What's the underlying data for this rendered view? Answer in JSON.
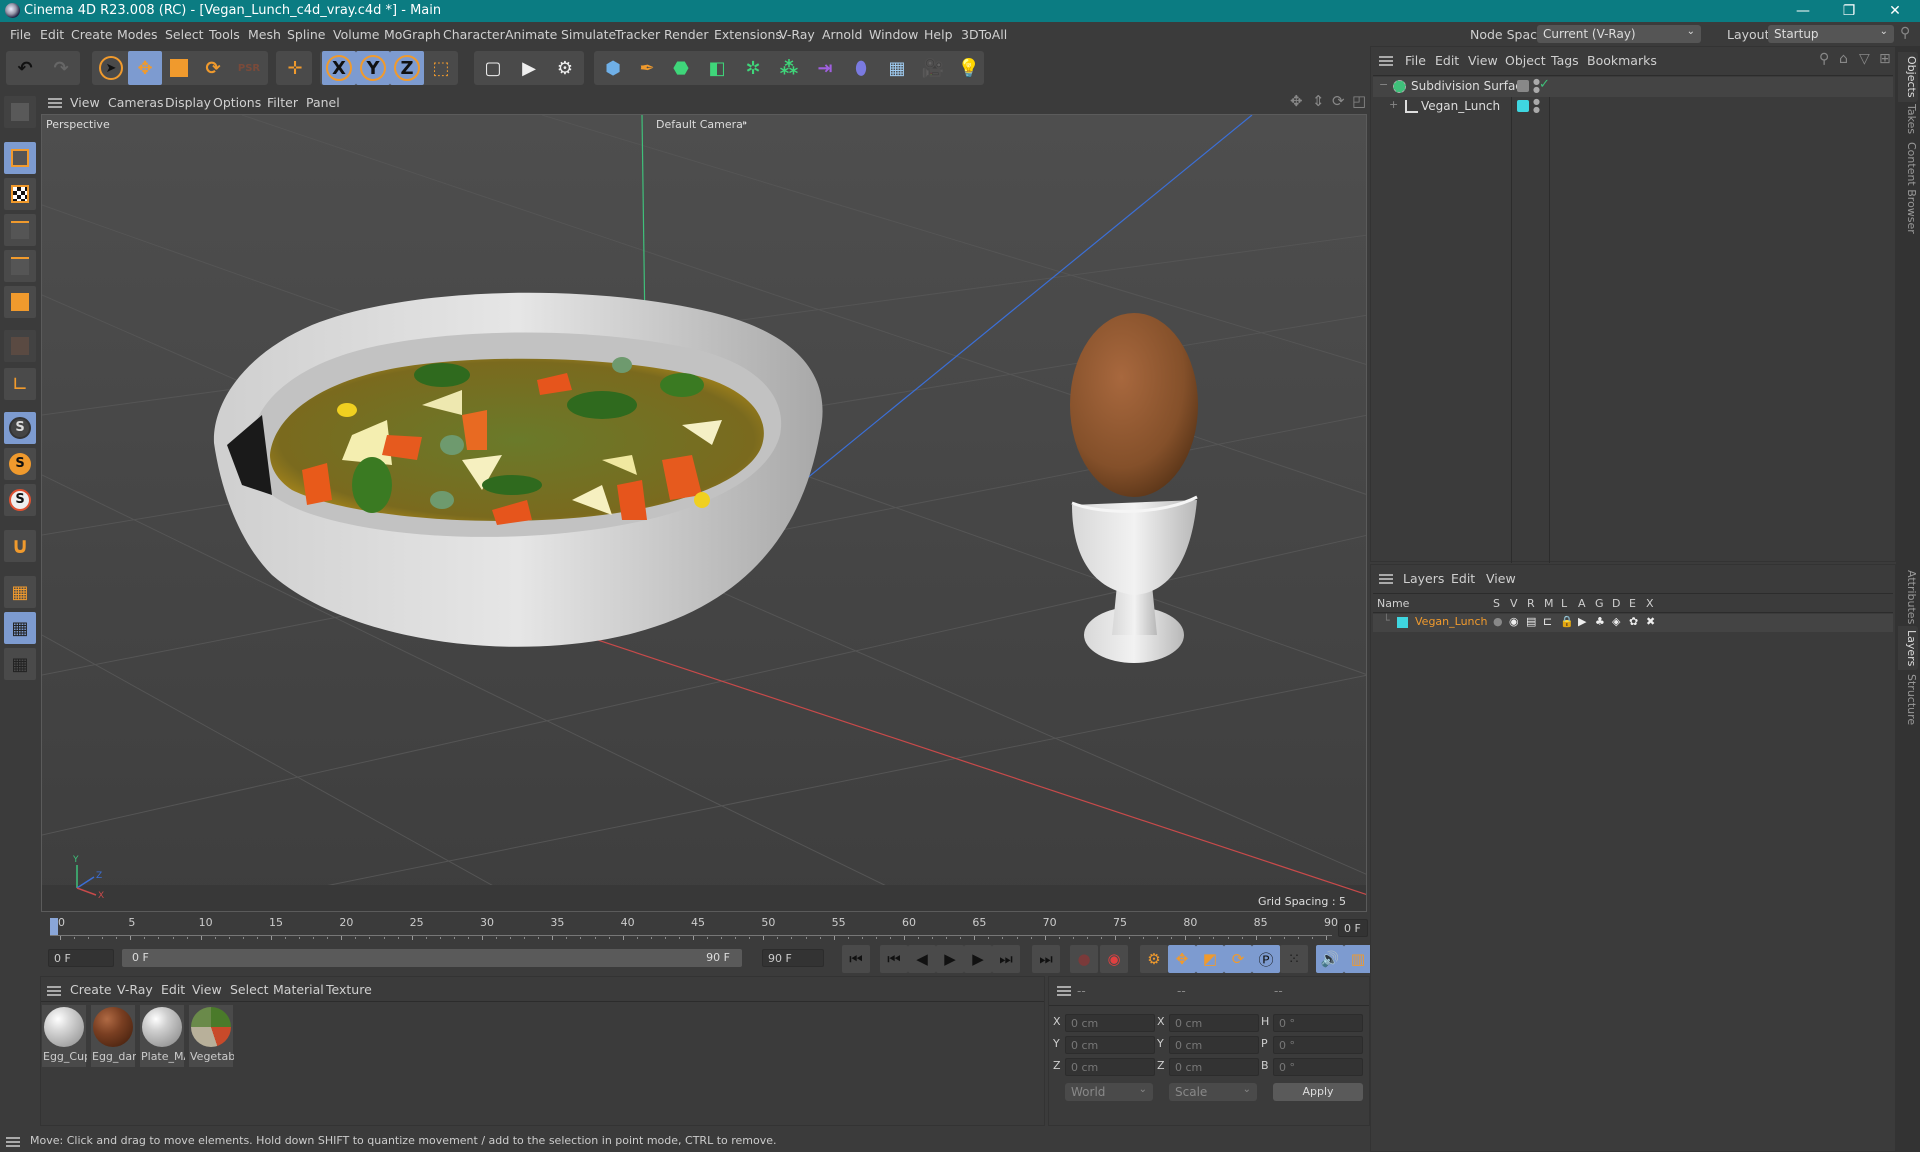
{
  "titlebar": {
    "title": "Cinema 4D R23.008 (RC) - [Vegan_Lunch_c4d_vray.c4d *] - Main",
    "minimize": "—",
    "maximize": "❐",
    "close": "✕"
  },
  "menubar": {
    "items": [
      "File",
      "Edit",
      "Create",
      "Modes",
      "Select",
      "Tools",
      "Mesh",
      "Spline",
      "Volume",
      "MoGraph",
      "Character",
      "Animate",
      "Simulate",
      "Tracker",
      "Render",
      "Extensions",
      "V-Ray",
      "Arnold",
      "Window",
      "Help",
      "3DToAll"
    ],
    "node_space_label": "Node Space:",
    "node_space_value": "Current (V-Ray)",
    "layout_label": "Layout:",
    "layout_value": "Startup"
  },
  "toolbar": {
    "undo": "undo-icon",
    "redo": "redo-icon",
    "axis_x": "X",
    "axis_y": "Y",
    "axis_z": "Z"
  },
  "viewport_menu": {
    "items": [
      "View",
      "Cameras",
      "Display",
      "Options",
      "Filter",
      "Panel"
    ]
  },
  "viewport": {
    "name": "Perspective",
    "camera": "Default Camera",
    "grid_spacing": "Grid Spacing : 5 cm",
    "axis_x": "X",
    "axis_y": "Y",
    "axis_z": "Z",
    "colors": {
      "x_axis": "#c84a4a",
      "y_axis": "#3fc07a",
      "z_axis": "#3b6fd6",
      "grid_bg": "#4a4a4a"
    }
  },
  "timeline": {
    "ticks": [
      "0",
      "5",
      "10",
      "15",
      "20",
      "25",
      "30",
      "35",
      "40",
      "45",
      "50",
      "55",
      "60",
      "65",
      "70",
      "75",
      "80",
      "85",
      "90"
    ],
    "current_frame": "0 F",
    "start_frame": "0 F",
    "range_start": "0 F",
    "range_end": "90 F",
    "end_frame": "90 F",
    "current_frame_right": "0 F"
  },
  "materials": {
    "menu": [
      "Create",
      "V-Ray",
      "Edit",
      "View",
      "Select",
      "Material",
      "Texture"
    ],
    "items": [
      {
        "label": "Egg_Cup",
        "color": "#d8d8d8"
      },
      {
        "label": "Egg_darl",
        "color": "#7a3f22"
      },
      {
        "label": "Plate_MA",
        "color": "#d0d0d0"
      },
      {
        "label": "Vegetab",
        "color": "#8a8a6a"
      }
    ]
  },
  "coordinates": {
    "headers": [
      "--",
      "--",
      "--"
    ],
    "rows": [
      {
        "l1": "X",
        "v1": "0 cm",
        "l2": "X",
        "v2": "0 cm",
        "l3": "H",
        "v3": "0 °"
      },
      {
        "l1": "Y",
        "v1": "0 cm",
        "l2": "Y",
        "v2": "0 cm",
        "l3": "P",
        "v3": "0 °"
      },
      {
        "l1": "Z",
        "v1": "0 cm",
        "l2": "Z",
        "v2": "0 cm",
        "l3": "B",
        "v3": "0 °"
      }
    ],
    "space": "World",
    "mode": "Scale",
    "apply": "Apply"
  },
  "objects_panel": {
    "menu": [
      "File",
      "Edit",
      "View",
      "Object",
      "Tags",
      "Bookmarks"
    ],
    "items": [
      {
        "name": "Subdivision Surface",
        "expand": "−"
      },
      {
        "name": "Vegan_Lunch",
        "expand": "+",
        "color": "#3fd6e0"
      }
    ]
  },
  "layers_panel": {
    "menu": [
      "Layers",
      "Edit",
      "View"
    ],
    "columns": [
      "Name",
      "S",
      "V",
      "R",
      "M",
      "L",
      "A",
      "G",
      "D",
      "E",
      "X"
    ],
    "rows": [
      {
        "name": "Vegan_Lunch",
        "color": "#3fd6e0",
        "text_color": "#f09a2d"
      }
    ]
  },
  "side_tabs": {
    "top": [
      "Objects",
      "Takes",
      "Content Browser"
    ],
    "bottom": [
      "Attributes",
      "Layers",
      "Structure"
    ]
  },
  "status": {
    "text": "Move: Click and drag to move elements. Hold down SHIFT to quantize movement / add to the selection in point mode, CTRL to remove."
  }
}
